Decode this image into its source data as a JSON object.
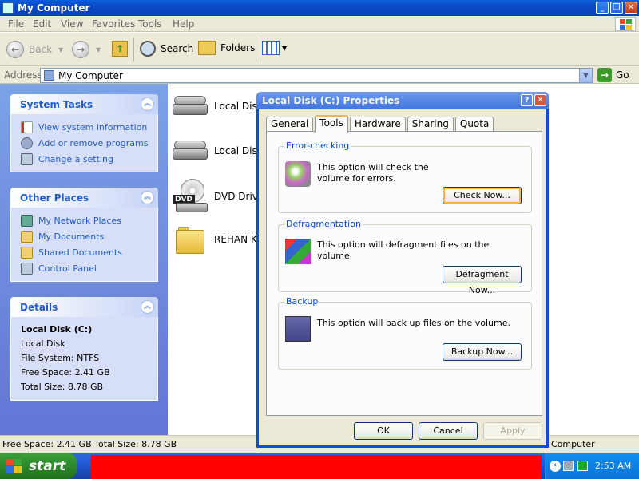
{
  "window": {
    "title": "My Computer",
    "menu": [
      "File",
      "Edit",
      "View",
      "Favorites",
      "Tools",
      "Help"
    ]
  },
  "toolbar": {
    "back_label": "Back",
    "search_label": "Search",
    "folders_label": "Folders"
  },
  "address": {
    "label": "Address",
    "value": "My Computer",
    "go_label": "Go"
  },
  "sidebar": {
    "system_tasks": {
      "title": "System Tasks",
      "items": [
        "View system information",
        "Add or remove programs",
        "Change a setting"
      ]
    },
    "other_places": {
      "title": "Other Places",
      "items": [
        "My Network Places",
        "My Documents",
        "Shared Documents",
        "Control Panel"
      ]
    },
    "details": {
      "title": "Details",
      "name": "Local Disk (C:)",
      "type": "Local Disk",
      "file_system": "File System: NTFS",
      "free_space": "Free Space: 2.41 GB",
      "total_size": "Total Size: 8.78 GB"
    }
  },
  "items": [
    {
      "label": "Local Disk",
      "icon": "hard-drive-icon"
    },
    {
      "label": "Local Disk",
      "icon": "hard-drive-icon"
    },
    {
      "label": "DVD Drive",
      "icon": "dvd-drive-icon"
    },
    {
      "label": "REHAN KH",
      "icon": "folder-icon"
    }
  ],
  "statusbar": {
    "left": "Free Space: 2.41 GB Total Size: 8.78 GB",
    "right": "Computer"
  },
  "taskbar": {
    "start_label": "start",
    "clock": "2:53 AM"
  },
  "dialog": {
    "title": "Local Disk (C:) Properties",
    "tabs": [
      "General",
      "Tools",
      "Hardware",
      "Sharing",
      "Quota"
    ],
    "active_tab": "Tools",
    "error_checking": {
      "title": "Error-checking",
      "text": "This option will check the volume for errors.",
      "button": "Check Now..."
    },
    "defragmentation": {
      "title": "Defragmentation",
      "text": "This option will defragment files on the volume.",
      "button": "Defragment Now..."
    },
    "backup": {
      "title": "Backup",
      "text": "This option will back up files on the volume.",
      "button": "Backup Now..."
    },
    "ok_label": "OK",
    "cancel_label": "Cancel",
    "apply_label": "Apply"
  }
}
